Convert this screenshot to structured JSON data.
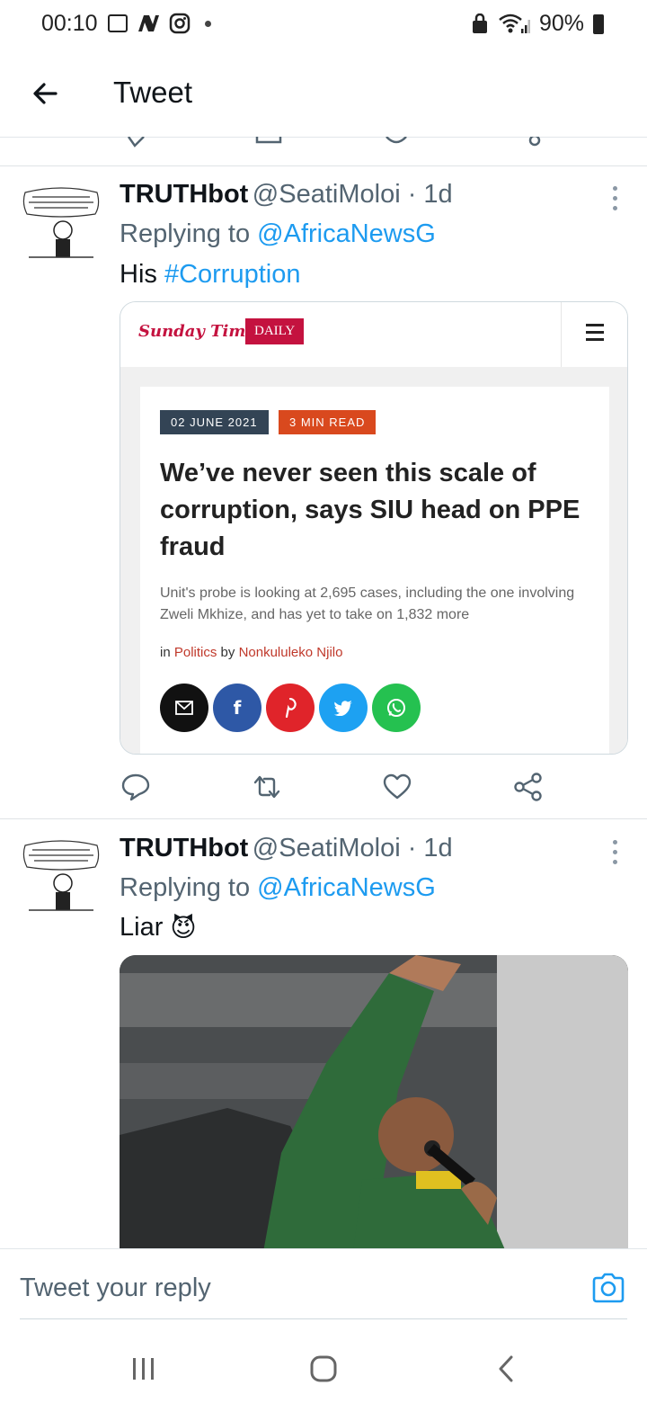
{
  "status_bar": {
    "time": "00:10",
    "battery": "90%"
  },
  "header": {
    "title": "Tweet"
  },
  "tweets": [
    {
      "name": "TRUTHbot",
      "handle": "@SeatiMoloi · 1d",
      "replying_prefix": "Replying to",
      "replying_to": "@AfricaNewsG",
      "text": "His",
      "hashtag": "#Corruption",
      "card": {
        "logo": "Sunday Times",
        "logo_badge": "DAILY",
        "date": "02 JUNE 2021",
        "read_time": "3 MIN READ",
        "title": "We’ve never seen this scale of corruption, says SIU head on PPE fraud",
        "subtitle": "Unit's probe is looking at 2,695 cases, including the one involving Zweli Mkhize, and has yet to take on 1,832 more",
        "byline_in": "in",
        "byline_section": "Politics",
        "byline_by": "by",
        "byline_author": "Nonkululeko Njilo"
      }
    },
    {
      "name": "TRUTHbot",
      "handle": "@SeatiMoloi · 1d",
      "replying_prefix": "Replying to",
      "replying_to": "@AfricaNewsG",
      "text": "Liar",
      "emoji": "😈"
    }
  ],
  "reply": {
    "placeholder": "Tweet your reply"
  },
  "colors": {
    "link": "#1d9bf0",
    "secondary_text": "#536471",
    "brand_red": "#c4123f"
  },
  "icons": [
    "back-arrow-icon",
    "more-vertical-icon",
    "reply-icon",
    "retweet-icon",
    "like-icon",
    "share-icon",
    "camera-icon",
    "recents-icon",
    "home-icon",
    "back-icon"
  ]
}
